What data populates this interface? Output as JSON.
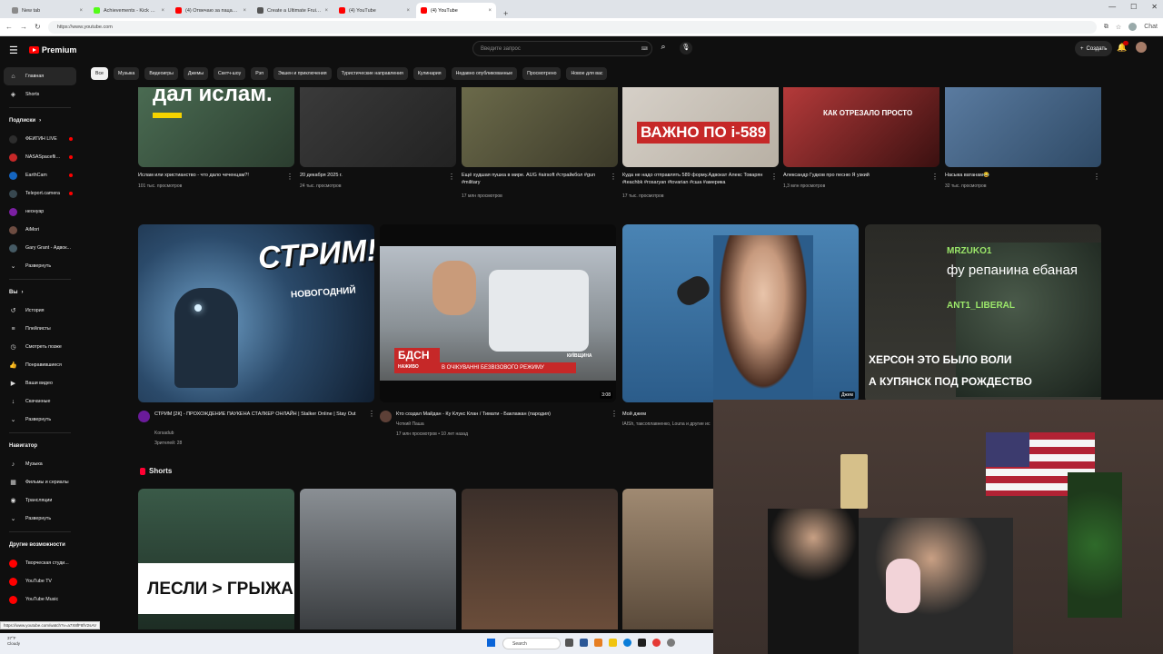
{
  "browser": {
    "tabs": [
      {
        "label": "New tab",
        "color": "#8a8a8a"
      },
      {
        "label": "Achievements - Kick Dashboard",
        "color": "#53fc18"
      },
      {
        "label": "(4) Отвечаю за пацана - YouTube",
        "color": "#ff0000"
      },
      {
        "label": "Create a Ultimate Fruit - Labeled",
        "color": "#555555"
      },
      {
        "label": "(4) YouTube",
        "color": "#ff0000"
      },
      {
        "label": "(4) YouTube",
        "color": "#ff0000",
        "active": true
      }
    ],
    "new_tab": "+",
    "url": "https://www.youtube.com",
    "chat_label": "Chat",
    "status_url": "https://www.youtube.com/watch?v=a7X8fF8fV2sAV"
  },
  "header": {
    "logo_text": "Premium",
    "search_placeholder": "Введите запрос",
    "create_label": "Создать",
    "notification_count": "9+"
  },
  "chips": [
    "Все",
    "Музыка",
    "Видеоигры",
    "Джемы",
    "Скетч-шоу",
    "Рэп",
    "Экшен и приключения",
    "Туристические направления",
    "Кулинария",
    "Недавно опубликованные",
    "Просмотрено",
    "Новое для вас"
  ],
  "sidebar": {
    "main": [
      {
        "label": "Главная",
        "icon": "home-icon",
        "active": true
      },
      {
        "label": "Shorts",
        "icon": "shorts-icon"
      }
    ],
    "subs_title": "Подписки",
    "subs": [
      {
        "label": "ФЕЙГИН LIVE",
        "color": "#2d2d2d",
        "live": true
      },
      {
        "label": "NASASpaceflight",
        "color": "#c62828",
        "live": true
      },
      {
        "label": "EarthCam",
        "color": "#1565c0",
        "live": true
      },
      {
        "label": "Teleport.camera",
        "color": "#37474f",
        "live": true
      },
      {
        "label": "неонуар",
        "color": "#7b1fa2",
        "live": false
      },
      {
        "label": "AiMori",
        "color": "#6d4c41",
        "live": false
      },
      {
        "label": "Gary Grant - Адвок...",
        "color": "#455a64",
        "live": false
      }
    ],
    "subs_more": "Развернуть",
    "you_title": "Вы",
    "you": [
      {
        "label": "История",
        "icon": "history-icon"
      },
      {
        "label": "Плейлисты",
        "icon": "playlist-icon"
      },
      {
        "label": "Смотреть позже",
        "icon": "clock-icon"
      },
      {
        "label": "Понравившиеся",
        "icon": "like-icon"
      },
      {
        "label": "Ваши видео",
        "icon": "video-icon"
      },
      {
        "label": "Скачанные",
        "icon": "download-icon"
      },
      {
        "label": "Развернуть",
        "icon": "chevron-down-icon"
      }
    ],
    "nav_title": "Навигатор",
    "nav": [
      {
        "label": "Музыка",
        "icon": "music-icon"
      },
      {
        "label": "Фильмы и сериалы",
        "icon": "film-icon"
      },
      {
        "label": "Трансляции",
        "icon": "live-icon"
      },
      {
        "label": "Развернуть",
        "icon": "chevron-down-icon"
      }
    ],
    "more_title": "Другие возможности",
    "more": [
      {
        "label": "Творческая студи...",
        "color": "#ff0000"
      },
      {
        "label": "YouTube TV",
        "color": "#ff0000"
      },
      {
        "label": "YouTube Music",
        "color": "#ff0000"
      }
    ]
  },
  "row1": [
    {
      "title": "Ислам или христианство - что дало чеченцам?!",
      "meta": "101 тыс. просмотров",
      "thumb_text": "дал ислам."
    },
    {
      "title": "20 декабря 2025 г.",
      "meta": "24 тыс. просмотров",
      "thumb_text": ""
    },
    {
      "title": "Ещё худшая пушка в мире. AUG #airsoft #страйкбол #gun #military",
      "meta": "17 млн просмотров",
      "thumb_text": ""
    },
    {
      "title": "Куда не надо отправлять 589 форму.Адвокат Алекс Товарян #teachbk #rosaryan #tovarian #сша #америка",
      "meta": "17 тыс. просмотров",
      "thumb_text": "ВАЖНО ПО i-589"
    },
    {
      "title": "Александр Гудков про песню Я узкий",
      "meta": "1,3 млн просмотров",
      "thumb_text": "КАК ОТРЕЗАЛО ПРОСТО"
    },
    {
      "title": "Насыка ватанам😂",
      "meta": "32 тыс. просмотров",
      "thumb_text": ""
    }
  ],
  "row2": [
    {
      "title": "СТРИМ [2К] - ПРОХОЖДЕНИЕ ПАУКЕНА СТАЛКЕР ОНЛАЙН | Stalker Online | Stay Out",
      "channel": "Korsadub",
      "meta": "Зрителей: 28",
      "thumb_big": "СТРИМ!",
      "thumb_small": "НОВОГОДНИЙ"
    },
    {
      "title": "Кто создал Майдан - Ку Клукс Клан / Тимати - Баклажан (пародия)",
      "channel": "Чоткий Паша",
      "meta": "17 млн просмотров • 10 лет назад",
      "duration": "3:08",
      "thumb_big": "БДСН",
      "thumb_small": "В ОЧІКУВАННІ БЕЗВІЗОВОГО РЕЖИМУ",
      "thumb_tag": "НАЖИВО",
      "thumb_city": "КИЇВЩИНА"
    },
    {
      "title": "Мой джем",
      "channel": "IAISh, таксоплавненко, Louna и другие ис",
      "meta": "",
      "duration": "Джем"
    },
    {
      "title": "",
      "channel": "",
      "meta": "",
      "thumb_overlay_1": "MRZUKO1",
      "thumb_overlay_2": "фу репанина ебаная",
      "thumb_overlay_3": "ANT1_LIBERAL",
      "thumb_overlay_4": "ХЕРСОН ЭТО БЫЛО ВОЛИ",
      "thumb_overlay_5": "А КУПЯНСК ПОД РОЖДЕСТВО"
    }
  ],
  "shorts_title": "Shorts",
  "shorts": [
    {
      "thumb_text": "ЛЕСЛИ > ГРЫЖА"
    },
    {
      "thumb_text": ""
    },
    {
      "thumb_text": ""
    },
    {
      "thumb_text": ""
    }
  ],
  "taskbar": {
    "search_label": "Search",
    "weather_temp": "37°F",
    "weather_label": "Cloudy"
  }
}
